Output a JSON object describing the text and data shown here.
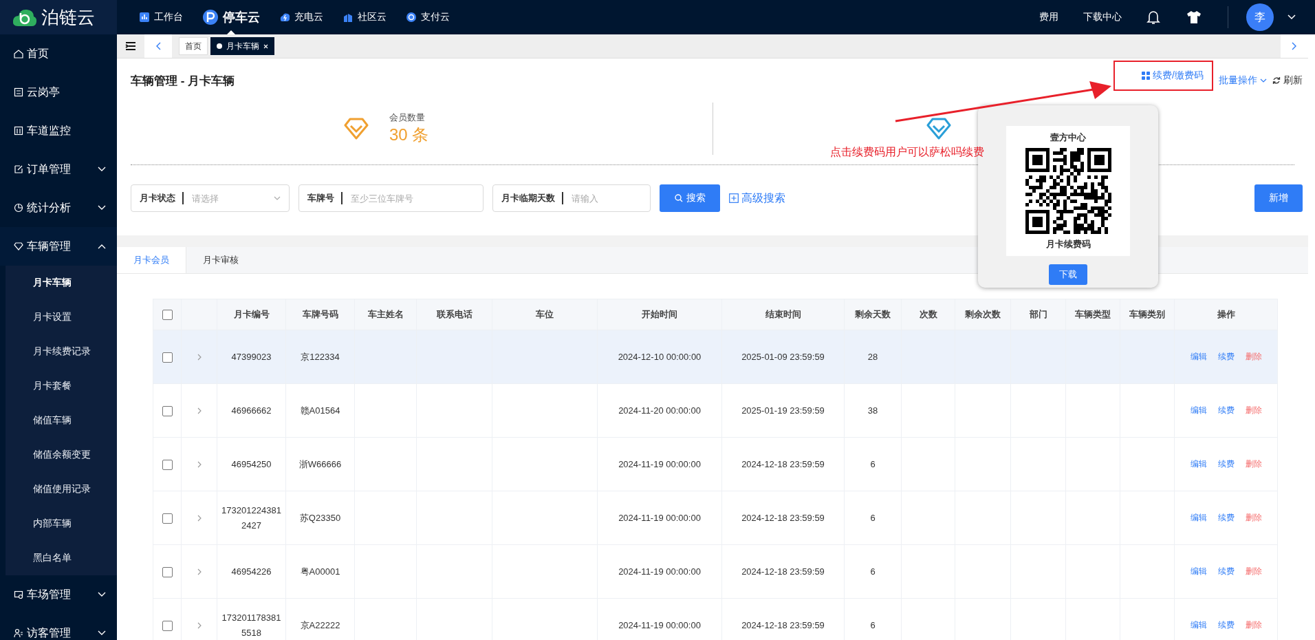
{
  "brand": {
    "name": "泊链云"
  },
  "top_nav": [
    {
      "label": "工作台",
      "selected": false
    },
    {
      "label": "停车云",
      "selected": true
    },
    {
      "label": "充电云",
      "selected": false
    },
    {
      "label": "社区云",
      "selected": false
    },
    {
      "label": "支付云",
      "selected": false
    }
  ],
  "header_links": [
    "费用",
    "下载中心"
  ],
  "user": {
    "avatar": "李"
  },
  "sidebar": {
    "items": [
      {
        "label": "首页",
        "kind": "link"
      },
      {
        "label": "云岗亭",
        "kind": "link"
      },
      {
        "label": "车道监控",
        "kind": "link"
      },
      {
        "label": "订单管理",
        "kind": "group",
        "expanded": false
      },
      {
        "label": "统计分析",
        "kind": "group",
        "expanded": false
      },
      {
        "label": "车辆管理",
        "kind": "group",
        "expanded": true,
        "children": [
          {
            "label": "月卡车辆",
            "selected": true
          },
          {
            "label": "月卡设置",
            "selected": false
          },
          {
            "label": "月卡续费记录",
            "selected": false
          },
          {
            "label": "月卡套餐",
            "selected": false
          },
          {
            "label": "储值车辆",
            "selected": false
          },
          {
            "label": "储值余额变更",
            "selected": false
          },
          {
            "label": "储值使用记录",
            "selected": false
          },
          {
            "label": "内部车辆",
            "selected": false
          },
          {
            "label": "黑白名单",
            "selected": false
          }
        ]
      },
      {
        "label": "车场管理",
        "kind": "group",
        "expanded": false
      },
      {
        "label": "访客管理",
        "kind": "group",
        "expanded": false
      }
    ]
  },
  "page_tabs": [
    {
      "label": "首页",
      "selected": false
    },
    {
      "label": "月卡车辆",
      "selected": true
    }
  ],
  "page": {
    "title": "车辆管理 - 月卡车辆",
    "toolbar": {
      "renew_code": "续费/缴费码",
      "batch": "批量操作",
      "refresh": "刷新"
    }
  },
  "stats": [
    {
      "label": "会员数量",
      "value": "30 条"
    }
  ],
  "filters": [
    {
      "label": "月卡状态",
      "placeholder": "请选择",
      "kind": "select"
    },
    {
      "label": "车牌号",
      "placeholder": "至少三位车牌号",
      "kind": "text"
    },
    {
      "label": "月卡临期天数",
      "placeholder": "请输入",
      "kind": "text"
    }
  ],
  "search_button": "搜索",
  "advanced_search": "高级搜索",
  "add_button": "新增",
  "list_tabs": [
    {
      "label": "月卡会员",
      "selected": true
    },
    {
      "label": "月卡审核",
      "selected": false
    }
  ],
  "table": {
    "header_checked": false,
    "columns": [
      "月卡编号",
      "车牌号码",
      "车主姓名",
      "联系电话",
      "车位",
      "开始时间",
      "结束时间",
      "剩余天数",
      "次数",
      "剩余次数",
      "部门",
      "车辆类型",
      "车辆类别",
      "操作"
    ],
    "rows": [
      {
        "checked": false,
        "highlighted": true,
        "card_no": "47399023",
        "plate": "京122334",
        "start": "2024-12-10 00:00:00",
        "end": "2025-01-09 23:59:59",
        "days_left": "28",
        "actions": [
          {
            "label": "编辑",
            "kind": "normal"
          },
          {
            "label": "续费",
            "kind": "normal"
          },
          {
            "label": "删除",
            "kind": "danger"
          }
        ]
      },
      {
        "checked": false,
        "highlighted": false,
        "card_no": "46966662",
        "plate": "赣A01564",
        "start": "2024-11-20 00:00:00",
        "end": "2025-01-19 23:59:59",
        "days_left": "38",
        "actions": [
          {
            "label": "编辑",
            "kind": "normal"
          },
          {
            "label": "续费",
            "kind": "normal"
          },
          {
            "label": "删除",
            "kind": "danger"
          }
        ]
      },
      {
        "checked": false,
        "highlighted": false,
        "card_no": "46954250",
        "plate": "浙W66666",
        "start": "2024-11-19 00:00:00",
        "end": "2024-12-18 23:59:59",
        "days_left": "6",
        "actions": [
          {
            "label": "编辑",
            "kind": "normal"
          },
          {
            "label": "续费",
            "kind": "normal"
          },
          {
            "label": "删除",
            "kind": "danger"
          }
        ]
      },
      {
        "checked": false,
        "highlighted": false,
        "card_no": "1732012243812427",
        "plate": "苏Q23350",
        "start": "2024-11-19 00:00:00",
        "end": "2024-12-18 23:59:59",
        "days_left": "6",
        "actions": [
          {
            "label": "编辑",
            "kind": "normal"
          },
          {
            "label": "续费",
            "kind": "normal"
          },
          {
            "label": "删除",
            "kind": "danger"
          }
        ]
      },
      {
        "checked": false,
        "highlighted": false,
        "card_no": "46954226",
        "plate": "粤A00001",
        "start": "2024-11-19 00:00:00",
        "end": "2024-12-18 23:59:59",
        "days_left": "6",
        "actions": [
          {
            "label": "编辑",
            "kind": "normal"
          },
          {
            "label": "续费",
            "kind": "normal"
          },
          {
            "label": "删除",
            "kind": "danger"
          }
        ]
      },
      {
        "checked": false,
        "highlighted": false,
        "card_no": "1732011783815518",
        "plate": "京A22222",
        "start": "2024-11-19 00:00:00",
        "end": "2024-12-18 23:59:59",
        "days_left": "6",
        "actions": [
          {
            "label": "编辑",
            "kind": "normal"
          },
          {
            "label": "续费",
            "kind": "normal"
          },
          {
            "label": "删除",
            "kind": "danger"
          }
        ]
      }
    ]
  },
  "qr_popup": {
    "title": "壹方中心",
    "caption": "月卡续费码",
    "button": "下载"
  },
  "annotation": {
    "note": "点击续费码用户可以萨松吗续费"
  }
}
